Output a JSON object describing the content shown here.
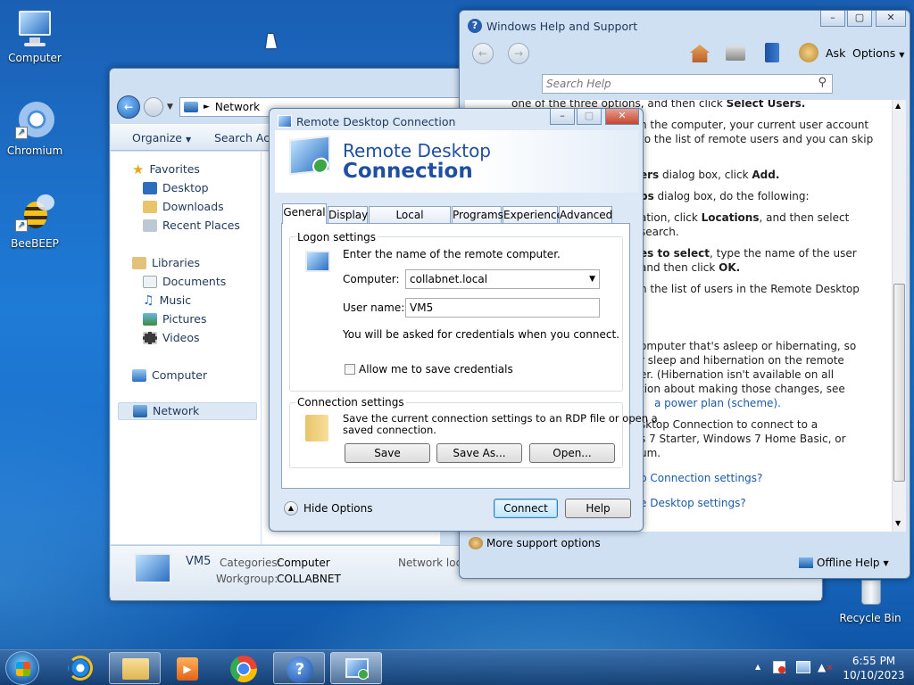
{
  "desktop": {
    "icons": [
      {
        "label": "Computer"
      },
      {
        "label": "Chromium"
      },
      {
        "label": "BeeBEEP"
      },
      {
        "label": "Recycle Bin"
      }
    ]
  },
  "explorer": {
    "address": {
      "root": "Network"
    },
    "toolbar": {
      "organize": "Organize",
      "search": "Search Active Directory"
    },
    "nav": {
      "favorites": "Favorites",
      "desktop": "Desktop",
      "downloads": "Downloads",
      "recent": "Recent Places",
      "libraries": "Libraries",
      "documents": "Documents",
      "music": "Music",
      "pictures": "Pictures",
      "videos": "Videos",
      "computer": "Computer",
      "network": "Network"
    },
    "details": {
      "name": "VM5",
      "categories_label": "Categories:",
      "categories_value": "Computer",
      "workgroup_label": "Workgroup:",
      "workgroup_value": "COLLABNET",
      "network_location": "Network location"
    }
  },
  "help": {
    "title": "Windows Help and Support",
    "ask": "Ask",
    "options": "Options",
    "search_placeholder": "Search Help",
    "lines": [
      {
        "pre": "one of the three options, and then click ",
        "b": "Select Users.",
        "post": ""
      },
      {
        "pre": "n the computer, your current user account",
        "b": "",
        "post": ""
      },
      {
        "pre": "to the list of remote users and you can skip",
        "b": "",
        "post": ""
      },
      {
        "pre": "",
        "b": "ers",
        "post": " dialog box, click "
      },
      {
        "pre": "",
        "b": "ps",
        "post": " dialog box, do the following:"
      },
      {
        "pre": "ation, click ",
        "b": "Locations",
        "post": ", and then select"
      },
      {
        "pre": "search.",
        "b": "",
        "post": ""
      },
      {
        "pre": "",
        "b": "es to select",
        "post": ", type the name of the user"
      },
      {
        "pre": "and then click ",
        "b": "OK.",
        "post": ""
      },
      {
        "pre": "n the list of users in the Remote Desktop",
        "b": "",
        "post": ""
      },
      {
        "pre": "omputer that's asleep or hibernating, so",
        "b": "",
        "post": ""
      },
      {
        "pre": "r sleep and hibernation on the remote",
        "b": "",
        "post": ""
      },
      {
        "pre": "er. (Hibernation isn't available on all",
        "b": "",
        "post": ""
      },
      {
        "pre": "tion about making those changes, see",
        "b": "",
        "post": ""
      },
      {
        "pre": "sktop Connection to connect to a",
        "b": "",
        "post": ""
      },
      {
        "pre": "s 7 Starter, Windows 7 Home Basic, or",
        "b": "",
        "post": ""
      },
      {
        "pre": "um.",
        "b": "",
        "post": ""
      }
    ],
    "add_bold": "Add.",
    "link1": "a power plan (scheme).",
    "link2": "p Connection settings?",
    "link3": "e Desktop settings?",
    "more_support": "More support options",
    "offline": "Offline Help"
  },
  "rdp": {
    "title": "Remote Desktop Connection",
    "banner_line1": "Remote Desktop",
    "banner_line2": "Connection",
    "tabs": [
      "General",
      "Display",
      "Local Resources",
      "Programs",
      "Experience",
      "Advanced"
    ],
    "logon_group": "Logon settings",
    "logon_intro": "Enter the name of the remote computer.",
    "computer_label": "Computer:",
    "computer_value": "collabnet.local",
    "username_label": "User name:",
    "username_value": "VM5",
    "credentials_note": "You will be asked for credentials when you connect.",
    "allow_save": "Allow me to save credentials",
    "conn_group": "Connection settings",
    "conn_text_1": "Save the current connection settings to an RDP file or open a",
    "conn_text_2": "saved connection.",
    "save": "Save",
    "save_as": "Save As...",
    "open": "Open...",
    "hide_options": "Hide Options",
    "connect": "Connect",
    "help": "Help"
  },
  "tray": {
    "time": "6:55 PM",
    "date": "10/10/2023"
  },
  "colors": {
    "accent": "#1a5aa8",
    "title_text": "#1e395b",
    "banner_blue": "#1e4fa0"
  }
}
